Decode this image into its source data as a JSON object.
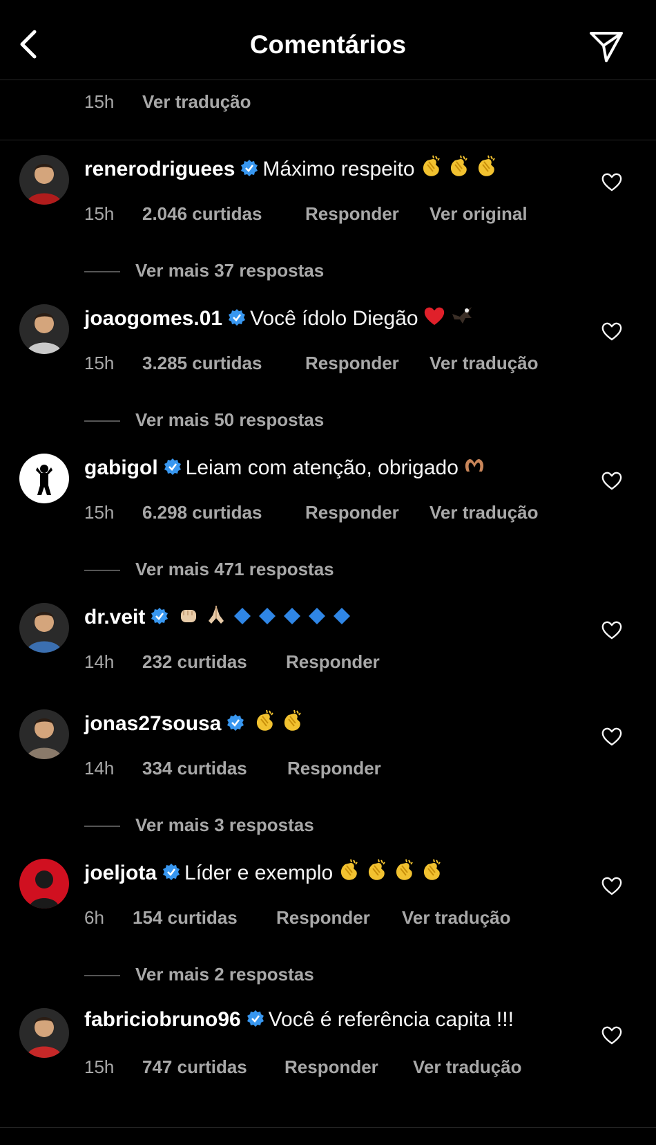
{
  "header": {
    "title": "Comentários",
    "back_icon": "chevron-left-icon",
    "share_icon": "paper-plane-icon"
  },
  "previous": {
    "time": "15h",
    "translate": "Ver tradução"
  },
  "comments": [
    {
      "username": "renerodriguees",
      "text": "Máximo respeito",
      "emojis": [
        "clap",
        "clap",
        "clap"
      ],
      "time": "15h",
      "likes": "2.046 curtidas",
      "reply": "Responder",
      "extra": "Ver original",
      "more_replies": "Ver mais 37 respostas",
      "avatar_color": "#b01c1c"
    },
    {
      "username": "joaogomes.01",
      "text": "Você ídolo Diegão",
      "emojis": [
        "heart",
        "eagle"
      ],
      "time": "15h",
      "likes": "3.285 curtidas",
      "reply": "Responder",
      "extra": "Ver tradução",
      "more_replies": "Ver mais 50 respostas",
      "avatar_color": "#c9c9c9"
    },
    {
      "username": "gabigol",
      "text": "Leiam com atenção, obrigado",
      "emojis": [
        "heart-hands"
      ],
      "time": "15h",
      "likes": "6.298 curtidas",
      "reply": "Responder",
      "extra": "Ver tradução",
      "more_replies": "Ver mais 471 respostas",
      "avatar_color": "#ffffff"
    },
    {
      "username": "dr.veit",
      "text": "",
      "emojis": [
        "fist",
        "pray",
        "diamond",
        "diamond",
        "diamond",
        "diamond",
        "diamond"
      ],
      "time": "14h",
      "likes": "232 curtidas",
      "reply": "Responder",
      "extra": "",
      "more_replies": "",
      "avatar_color": "#3b6fb0"
    },
    {
      "username": "jonas27sousa",
      "text": "",
      "emojis": [
        "clap",
        "clap"
      ],
      "time": "14h",
      "likes": "334 curtidas",
      "reply": "Responder",
      "extra": "",
      "more_replies": "Ver mais 3 respostas",
      "avatar_color": "#8a7a6a"
    },
    {
      "username": "joeljota",
      "text": "Líder e exemplo",
      "emojis": [
        "clap",
        "clap",
        "clap",
        "clap"
      ],
      "time": "6h",
      "likes": "154 curtidas",
      "reply": "Responder",
      "extra": "Ver tradução",
      "more_replies": "Ver mais 2 respostas",
      "avatar_color": "#d01020"
    },
    {
      "username": "fabriciobruno96",
      "text": "Você é referência capita !!!",
      "emojis": [],
      "time": "15h",
      "likes": "747 curtidas",
      "reply": "Responder",
      "extra": "Ver tradução",
      "more_replies": "",
      "avatar_color": "#c62828"
    }
  ],
  "colors": {
    "background": "#000000",
    "text_primary": "#f5f5f5",
    "text_secondary": "#a8a8a8",
    "verified": "#3897f0",
    "divider": "#262626"
  }
}
